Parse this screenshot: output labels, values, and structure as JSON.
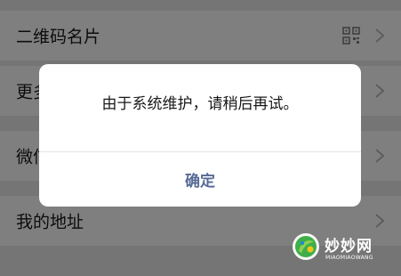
{
  "settings_rows": [
    {
      "label": "二维码名片"
    },
    {
      "label": "更多"
    },
    {
      "label": "微信"
    },
    {
      "label": "我的地址"
    }
  ],
  "dialog": {
    "message": "由于系统维护，请稍后再试。",
    "confirm_label": "确定"
  },
  "watermark": {
    "name": "妙妙网",
    "sub": "MIAOMIAOWANG"
  },
  "colors": {
    "background": "#ebebeb",
    "row_bg": "#ffffff",
    "text": "#191919",
    "dialog_button": "#576b95",
    "chevron": "#b2b2b2",
    "mask": "rgba(0,0,0,0.5)"
  },
  "icons": {
    "qr": "qr-code-icon",
    "chevron": "chevron-right-icon",
    "watermark": "miaomiao-logo-icon"
  }
}
